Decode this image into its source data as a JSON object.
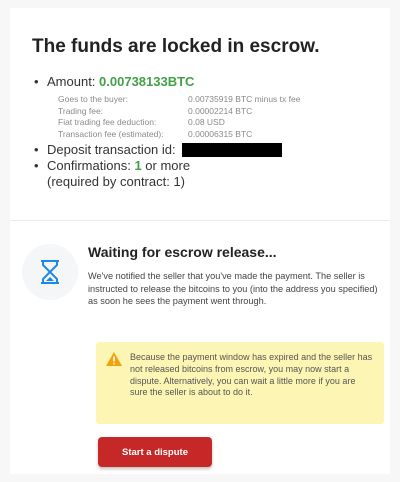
{
  "header": {
    "title": "The funds are locked in escrow."
  },
  "amount": {
    "label": "Amount:",
    "value": "0.00738133BTC"
  },
  "details": [
    {
      "label": "Goes to the buyer:",
      "value": "0.00735919 BTC minus tx fee"
    },
    {
      "label": "Trading fee:",
      "value": "0.00002214 BTC"
    },
    {
      "label": "Fiat trading fee deduction:",
      "value": "0.08 USD"
    },
    {
      "label": "Transaction fee (estimated):",
      "value": "0.00006315 BTC"
    }
  ],
  "deposit": {
    "label": "Deposit transaction id:"
  },
  "confirmations": {
    "label": "Confirmations:",
    "value": "1",
    "suffix": "or more",
    "note": "(required by contract: 1)"
  },
  "waiting": {
    "title": "Waiting for escrow release...",
    "text": "We've notified the seller that you've made the payment. The seller is instructed to release the bitcoins to you (into the address you specified) as soon he sees the payment went through."
  },
  "warning": {
    "text": "Because the payment window has expired and the seller has not released bitcoins from escrow, you may now start a dispute. Alternatively, you can wait a little more if you are sure the seller is about to do it."
  },
  "actions": {
    "dispute_label": "Start a dispute"
  },
  "colors": {
    "accent_green": "#43a047",
    "danger_red": "#c62828",
    "warning_bg": "#fdf5b4"
  },
  "icons": {
    "status": "hourglass-icon",
    "warning": "warning-triangle-icon"
  }
}
